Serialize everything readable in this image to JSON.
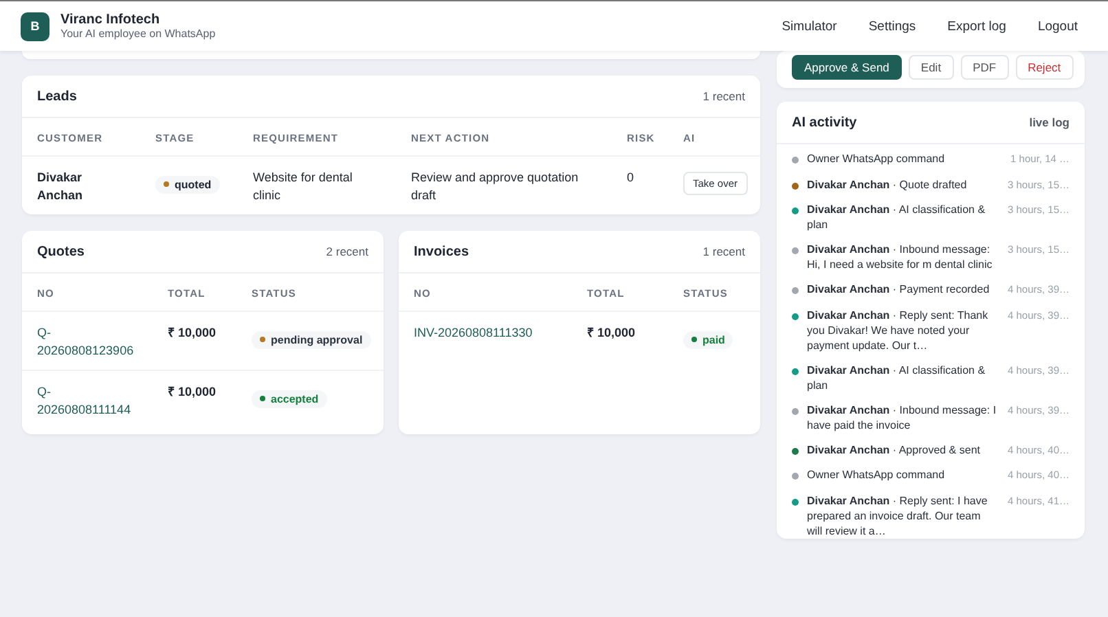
{
  "header": {
    "logo": "B",
    "title": "Viranc Infotech",
    "subtitle": "Your AI employee on WhatsApp",
    "nav": [
      "Simulator",
      "Settings",
      "Export log",
      "Logout"
    ]
  },
  "approval_actions": [
    {
      "label": "Approve & Send",
      "kind": "primary"
    },
    {
      "label": "Edit",
      "kind": "plain"
    },
    {
      "label": "PDF",
      "kind": "plain"
    },
    {
      "label": "Reject",
      "kind": "danger"
    }
  ],
  "leads": {
    "title": "Leads",
    "count": "1 recent",
    "columns": [
      "CUSTOMER",
      "STAGE",
      "REQUIREMENT",
      "NEXT ACTION",
      "RISK",
      "AI"
    ],
    "rows": [
      {
        "customer": "Divakar Anchan",
        "stage": "quoted",
        "color": "#b7791f",
        "requirement": "Website for dental clinic",
        "next_action": "Review and approve quotation draft",
        "risk": "0",
        "ai_action": "Take over"
      }
    ]
  },
  "quotes": {
    "title": "Quotes",
    "count": "2 recent",
    "columns": [
      "NO",
      "TOTAL",
      "STATUS"
    ],
    "rows": [
      {
        "no": "Q-20260808123906",
        "total": "₹ 10,000",
        "status": "pending approval",
        "color": "#b7791f"
      },
      {
        "no": "Q-20260808111144",
        "total": "₹ 10,000",
        "status": "accepted",
        "color": "#15803d"
      }
    ]
  },
  "invoices": {
    "title": "Invoices",
    "count": "1 recent",
    "columns": [
      "NO",
      "TOTAL",
      "STATUS"
    ],
    "rows": [
      {
        "no": "INV-20260808111330",
        "total": "₹ 10,000",
        "status": "paid",
        "color": "#15803d"
      }
    ]
  },
  "activity": {
    "title": "AI activity",
    "badge": "live log",
    "items": [
      {
        "text": "Owner WhatsApp command",
        "time": "1 hour, 14 …",
        "color": "#a3a8b0"
      },
      {
        "text": "**Divakar Anchan** · Quote drafted",
        "time": "3 hours, 15…",
        "color": "#a0661a"
      },
      {
        "text": "**Divakar Anchan** · AI classification & plan",
        "time": "3 hours, 15…",
        "color": "#149c86"
      },
      {
        "text": "**Divakar Anchan** · Inbound message: Hi, I need a website for m dental clinic",
        "time": "3 hours, 15…",
        "color": "#a3a8b0"
      },
      {
        "text": "**Divakar Anchan** · Payment recorded",
        "time": "4 hours, 39…",
        "color": "#a3a8b0"
      },
      {
        "text": "**Divakar Anchan** · Reply sent: Thank you Divakar! We have noted your payment update. Our t…",
        "time": "4 hours, 39…",
        "color": "#149c86"
      },
      {
        "text": "**Divakar Anchan** · AI classification & plan",
        "time": "4 hours, 39…",
        "color": "#149c86"
      },
      {
        "text": "**Divakar Anchan** · Inbound message: I have paid the invoice",
        "time": "4 hours, 39…",
        "color": "#a3a8b0"
      },
      {
        "text": "**Divakar Anchan** · Approved & sent",
        "time": "4 hours, 40…",
        "color": "#1e7a4a"
      },
      {
        "text": "Owner WhatsApp command",
        "time": "4 hours, 40…",
        "color": "#a3a8b0"
      },
      {
        "text": "**Divakar Anchan** · Reply sent: I have prepared an invoice draft. Our team will review it a…",
        "time": "4 hours, 41…",
        "color": "#149c86"
      }
    ]
  }
}
